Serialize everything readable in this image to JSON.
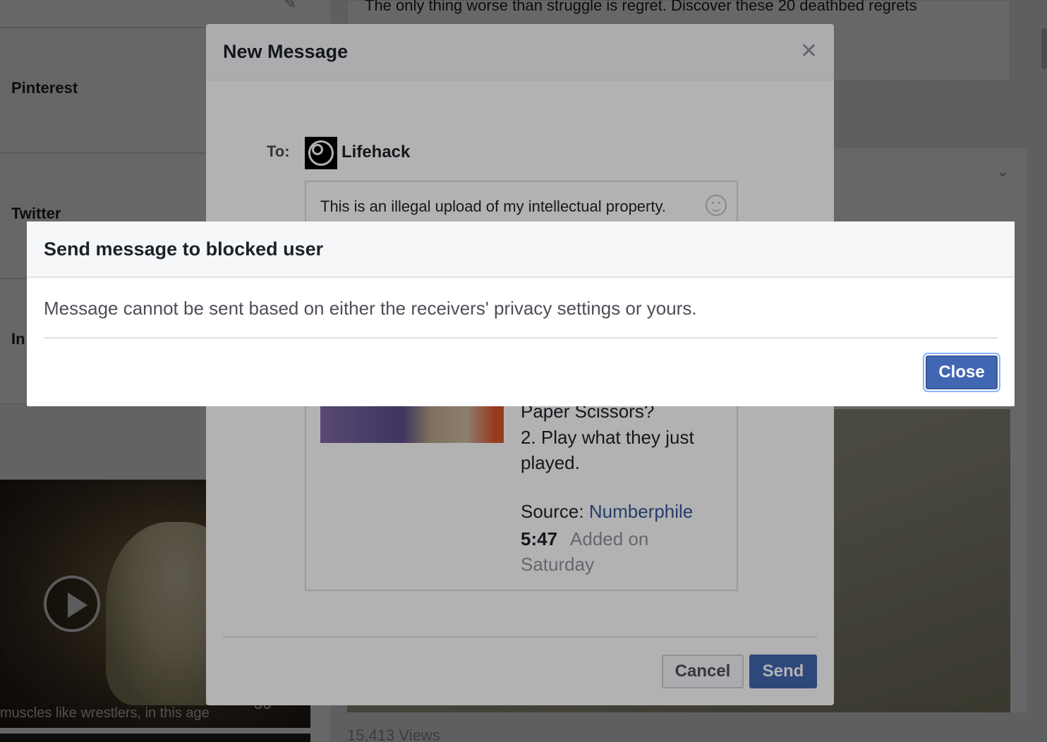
{
  "background": {
    "sidebar": {
      "items": [
        {
          "label": "Pinterest"
        },
        {
          "label": "Twitter"
        },
        {
          "label": "In"
        }
      ]
    },
    "feed": {
      "post_text": "The only thing worse than struggle is regret. Discover these 20 deathbed regrets",
      "video_caption": "muscles like wrestlers, in this age",
      "video_count": "36",
      "views": "15,413 Views"
    }
  },
  "new_message": {
    "title": "New Message",
    "close_glyph": "✕",
    "to_label": "To:",
    "recipient": "Lifehack",
    "message_text": "This is an illegal upload of my intellectual property. Remove it from Facebook, I said and",
    "attachment": {
      "line1": "Paper Scissors?",
      "desc": "2. Play what they just played.",
      "source_label": "Source:",
      "source_name": "Numberphile",
      "duration": "5:47",
      "added": "Added on Saturday"
    },
    "cancel_label": "Cancel",
    "send_label": "Send"
  },
  "alert": {
    "title": "Send message to blocked user",
    "body": "Message cannot be sent based on either the receivers' privacy settings or yours.",
    "close_label": "Close"
  }
}
